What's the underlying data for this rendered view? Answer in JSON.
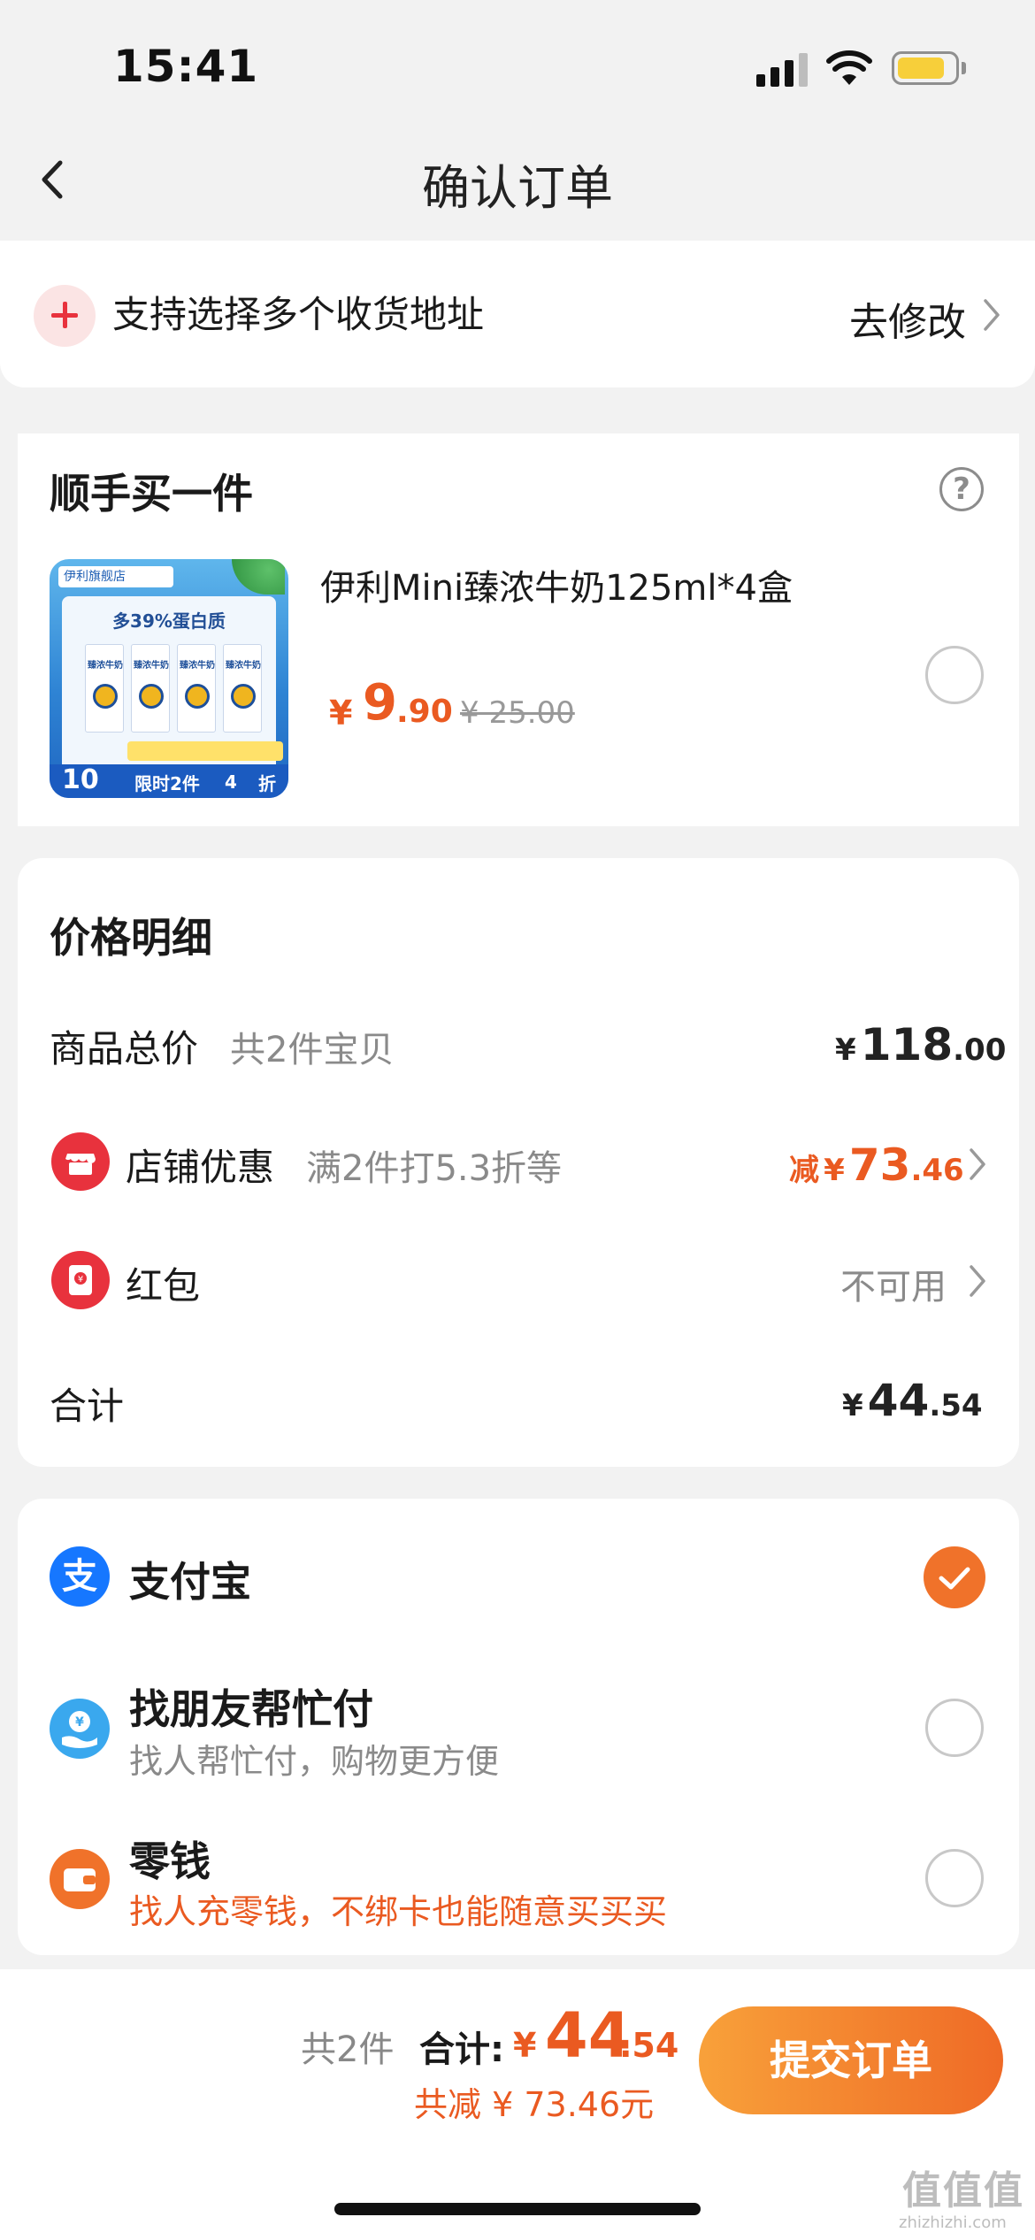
{
  "status_bar": {
    "time": "15:41"
  },
  "nav": {
    "title": "确认订单"
  },
  "address": {
    "text": "支持选择多个收货地址",
    "action": "去修改"
  },
  "addon": {
    "title": "顺手买一件",
    "product": {
      "name": "伊利Mini臻浓牛奶125ml*4盒",
      "currency": "¥",
      "price_int": "9",
      "price_dec": ".90",
      "original_price": "¥ 25.00",
      "thumb": {
        "store_tag": "伊利旗舰店",
        "headline": "多39%蛋白质",
        "carton_label": "臻浓牛奶",
        "number": "10",
        "limit": "限时2件",
        "discount_num": "4",
        "discount_unit": "折"
      }
    }
  },
  "price_detail": {
    "title": "价格明细",
    "goods_total": {
      "label": "商品总价",
      "sub": "共2件宝贝",
      "sym": "¥",
      "int": "118",
      "dec": ".00"
    },
    "store_discount": {
      "label": "店铺优惠",
      "sub": "满2件打5.3折等",
      "prefix": "减",
      "sym": "¥",
      "int": "73",
      "dec": ".46"
    },
    "red_packet": {
      "label": "红包",
      "value": "不可用"
    },
    "subtotal": {
      "label": "合计",
      "sym": "¥",
      "int": "44",
      "dec": ".54"
    }
  },
  "payment": {
    "methods": [
      {
        "name": "支付宝",
        "sub": "",
        "checked": true,
        "icon": "alipay-icon",
        "icon_char": "支"
      },
      {
        "name": "找朋友帮忙付",
        "sub": "找人帮忙付，购物更方便",
        "checked": false,
        "icon": "friend-pay-icon",
        "icon_char": "¥"
      },
      {
        "name": "零钱",
        "sub": "找人充零钱，不绑卡也能随意买买买",
        "checked": false,
        "icon": "wallet-icon",
        "icon_char": ""
      }
    ]
  },
  "footer": {
    "count": "共2件",
    "total_label": "合计:",
    "sym": "¥",
    "total_int": "44",
    "total_dec": ".54",
    "saved": "共减 ¥ 73.46元",
    "submit": "提交订单"
  },
  "watermark": {
    "logo": "值值值",
    "text": "zhizhizhi.com"
  },
  "colors": {
    "accent": "#ea5a21",
    "button_gradient_start": "#f8a13a",
    "button_gradient_end": "#ef6a26",
    "alipay_blue": "#1677ff",
    "red": "#e8323d"
  }
}
